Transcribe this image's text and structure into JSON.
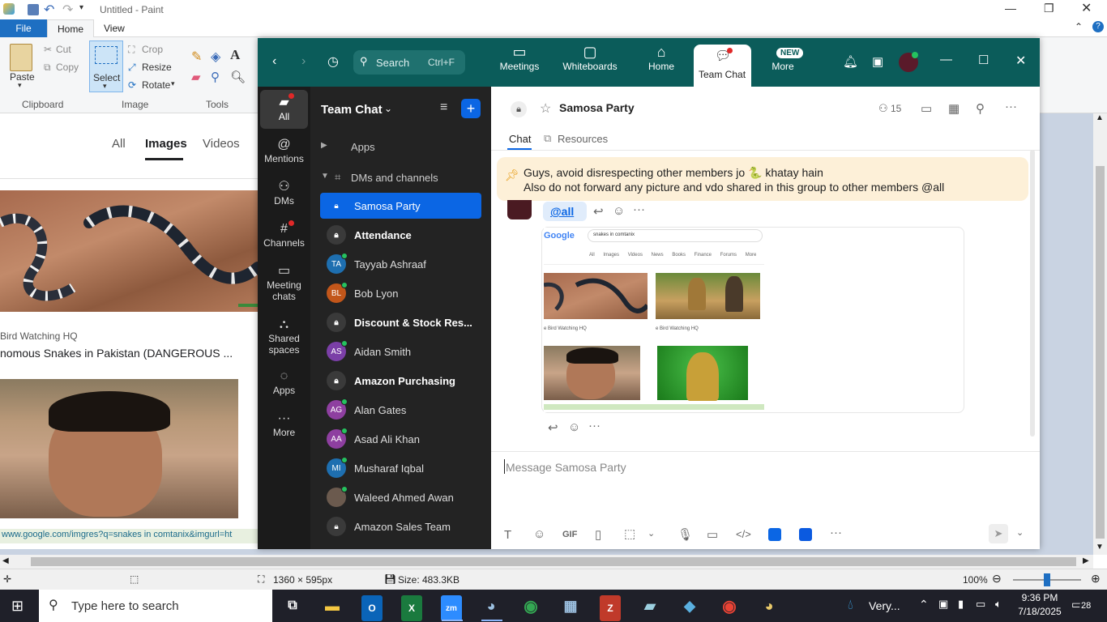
{
  "paint": {
    "title": "Untitled - Paint",
    "tabs": [
      "File",
      "Home",
      "View"
    ],
    "clipboard": {
      "paste": "Paste",
      "cut": "Cut",
      "copy": "Copy",
      "group": "Clipboard"
    },
    "image": {
      "select": "Select",
      "crop": "Crop",
      "resize": "Resize",
      "rotate": "Rotate",
      "group": "Image"
    },
    "tools": {
      "group": "Tools"
    },
    "status": {
      "dimensions": "1360 × 595px",
      "size": "Size: 483.3KB",
      "zoom": "100%"
    }
  },
  "browser": {
    "tabs": [
      "All",
      "Images",
      "Videos"
    ],
    "source": "Bird Watching HQ",
    "result_title": "nomous Snakes in Pakistan (DANGEROUS ...",
    "url": "www.google.com/imgres?q=snakes in comtanix&imgurl=ht"
  },
  "zoom": {
    "nav": {
      "search": "Search",
      "shortcut": "Ctrl+F",
      "items": [
        "Meetings",
        "Whiteboards",
        "Home",
        "Team Chat",
        "More"
      ],
      "new_badge": "NEW"
    },
    "rail": [
      "All",
      "Mentions",
      "DMs",
      "Channels",
      "Meeting chats",
      "Shared spaces",
      "Apps",
      "More"
    ],
    "sidebar": {
      "title": "Team Chat",
      "sections": [
        "Apps",
        "DMs and channels"
      ],
      "items": [
        {
          "name": "Samosa Party",
          "type": "lock",
          "bold": false
        },
        {
          "name": "Attendance",
          "type": "lock",
          "bold": true
        },
        {
          "name": "Tayyab Ashraaf",
          "initials": "TA",
          "color": "#1e6fb0"
        },
        {
          "name": "Bob Lyon",
          "initials": "BL",
          "color": "#c2561a"
        },
        {
          "name": "Discount & Stock Res...",
          "type": "lock",
          "bold": true
        },
        {
          "name": "Aidan Smith",
          "initials": "AS",
          "color": "#7b3fa7"
        },
        {
          "name": "Amazon Purchasing",
          "type": "lock",
          "bold": true
        },
        {
          "name": "Alan Gates",
          "initials": "AG",
          "color": "#8e3fa0"
        },
        {
          "name": "Asad Ali Khan",
          "initials": "AA",
          "color": "#8e3fa0"
        },
        {
          "name": "Musharaf Iqbal",
          "initials": "MI",
          "color": "#1e6fb0"
        },
        {
          "name": "Waleed Ahmed Awan",
          "initials": "",
          "color": "#6b5a4e"
        },
        {
          "name": "Amazon Sales Team",
          "type": "lock",
          "bold": false
        }
      ]
    },
    "channel": {
      "name": "Samosa Party",
      "members": "15",
      "tabs": [
        "Chat",
        "Resources"
      ]
    },
    "pinned": {
      "line1": "Guys, avoid disrespecting other members jo 🐍 khatay hain",
      "line2": "Also do not forward any picture and vdo shared in this group to other members @all"
    },
    "message": {
      "mention": "@all"
    },
    "screenshot": {
      "logo": "Google",
      "query": "snakes in comtanix",
      "tabs": [
        "All",
        "Images",
        "Videos",
        "News",
        "Books",
        "Finance",
        "Forums",
        "More"
      ],
      "cap1": "e Bird Watching HQ",
      "cap2": "e Bird Watching HQ"
    },
    "composer": {
      "placeholder": "Message Samosa Party",
      "gif": "GIF"
    }
  },
  "taskbar": {
    "search_placeholder": "Type here to search",
    "weather": "Very...",
    "time": "9:36 PM",
    "date": "7/18/2025",
    "notifications": "28"
  }
}
